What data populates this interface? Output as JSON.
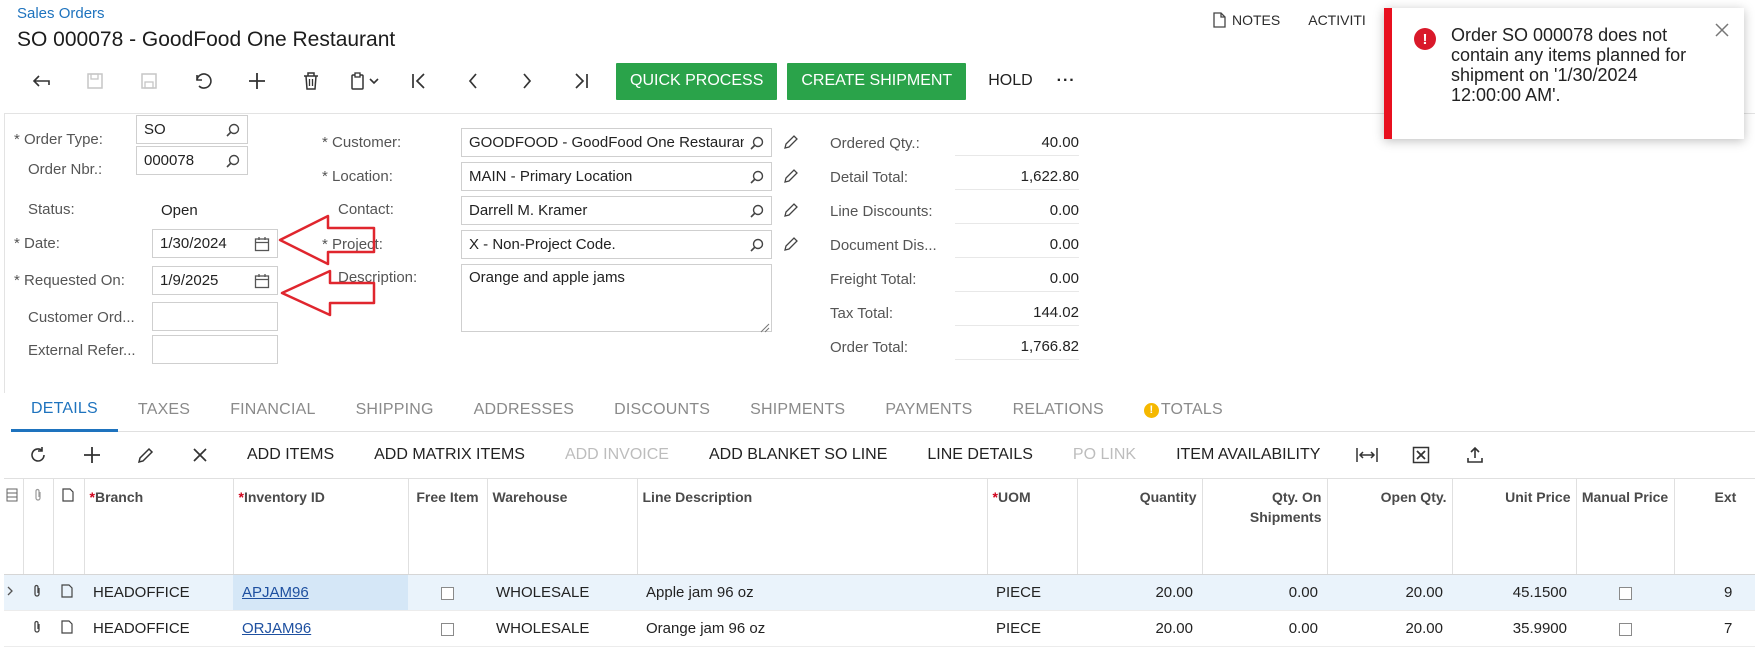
{
  "header": {
    "breadcrumb": "Sales Orders",
    "title": "SO 000078 - GoodFood One Restaurant",
    "notes_label": "NOTES",
    "activities_label": "ACTIVITI"
  },
  "toolbar": {
    "quick_process": "QUICK PROCESS",
    "create_shipment": "CREATE SHIPMENT",
    "hold": "HOLD",
    "more": "···",
    "accent": "#2aa34a"
  },
  "form": {
    "order_type": {
      "label": "Order Type:",
      "value": "SO"
    },
    "order_nbr": {
      "label": "Order Nbr.:",
      "value": "000078"
    },
    "status": {
      "label": "Status:",
      "value": "Open"
    },
    "date": {
      "label": "Date:",
      "value": "1/30/2024"
    },
    "requested_on": {
      "label": "Requested On:",
      "value": "1/9/2025"
    },
    "customer_ord": {
      "label": "Customer Ord...",
      "value": ""
    },
    "external_ref": {
      "label": "External Refer...",
      "value": ""
    },
    "customer": {
      "label": "Customer:",
      "value": "GOODFOOD - GoodFood One Restaurant"
    },
    "location": {
      "label": "Location:",
      "value": "MAIN - Primary Location"
    },
    "contact": {
      "label": "Contact:",
      "value": "Darrell M. Kramer"
    },
    "project": {
      "label": "Project:",
      "value": "X - Non-Project Code."
    },
    "description": {
      "label": "Description:",
      "value": "Orange and apple jams"
    }
  },
  "summary": [
    {
      "label": "Ordered Qty.:",
      "value": "40.00"
    },
    {
      "label": "Detail Total:",
      "value": "1,622.80"
    },
    {
      "label": "Line Discounts:",
      "value": "0.00"
    },
    {
      "label": "Document Dis...",
      "value": "0.00"
    },
    {
      "label": "Freight Total:",
      "value": "0.00"
    },
    {
      "label": "Tax Total:",
      "value": "144.02"
    },
    {
      "label": "Order Total:",
      "value": "1,766.82"
    }
  ],
  "tabs": [
    "DETAILS",
    "TAXES",
    "FINANCIAL",
    "SHIPPING",
    "ADDRESSES",
    "DISCOUNTS",
    "SHIPMENTS",
    "PAYMENTS",
    "RELATIONS",
    "TOTALS"
  ],
  "grid_toolbar": {
    "add_items": "ADD ITEMS",
    "add_matrix_items": "ADD MATRIX ITEMS",
    "add_invoice": "ADD INVOICE",
    "add_blanket": "ADD BLANKET SO LINE",
    "line_details": "LINE DETAILS",
    "po_link": "PO LINK",
    "item_availability": "ITEM AVAILABILITY"
  },
  "grid": {
    "columns": {
      "branch": "Branch",
      "inventory_id": "Inventory ID",
      "free_item": "Free Item",
      "warehouse": "Warehouse",
      "line_description": "Line Description",
      "uom": "UOM",
      "quantity": "Quantity",
      "qty_on_shipments": "Qty. On Shipments",
      "open_qty": "Open Qty.",
      "unit_price": "Unit Price",
      "manual_price": "Manual Price",
      "ext": "Ext"
    },
    "rows": [
      {
        "branch": "HEADOFFICE",
        "inventory_id": "APJAM96",
        "warehouse": "WHOLESALE",
        "description": "Apple jam 96 oz",
        "uom": "PIECE",
        "quantity": "20.00",
        "qty_on_shipments": "0.00",
        "open_qty": "20.00",
        "unit_price": "45.1500",
        "ext": "9"
      },
      {
        "branch": "HEADOFFICE",
        "inventory_id": "ORJAM96",
        "warehouse": "WHOLESALE",
        "description": "Orange jam 96 oz",
        "uom": "PIECE",
        "quantity": "20.00",
        "qty_on_shipments": "0.00",
        "open_qty": "20.00",
        "unit_price": "35.9900",
        "ext": "7"
      }
    ]
  },
  "toast": {
    "message": "Order SO 000078 does not contain any items planned for shipment on '1/30/2024 12:00:00 AM'.",
    "color": "#e8101f"
  }
}
